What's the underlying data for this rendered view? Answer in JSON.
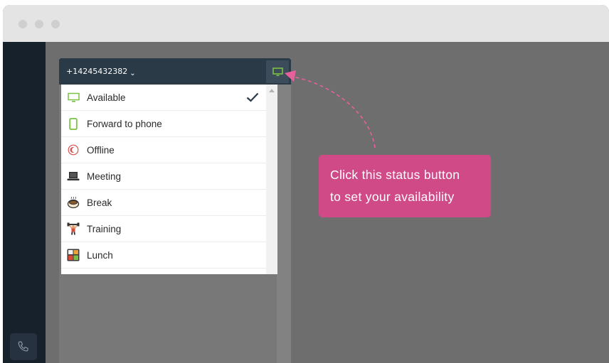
{
  "header": {
    "phone_number": "+14245432382",
    "dropdown_glyph": "⌄"
  },
  "status_menu": {
    "selected": "Available",
    "items": [
      {
        "label": "Available",
        "icon": "monitor-icon",
        "color": "#7ac142"
      },
      {
        "label": "Forward to phone",
        "icon": "mobile-icon",
        "color": "#7ac142"
      },
      {
        "label": "Offline",
        "icon": "moon-icon",
        "color": "#d9534f"
      },
      {
        "label": "Meeting",
        "icon": "laptop-icon"
      },
      {
        "label": "Break",
        "icon": "coffee-icon"
      },
      {
        "label": "Training",
        "icon": "weightlifter-icon"
      },
      {
        "label": "Lunch",
        "icon": "bento-icon"
      }
    ]
  },
  "callout": {
    "line1": "Click this status button",
    "line2": "to set your availability",
    "color": "#cf4a87"
  },
  "colors": {
    "sidebar": "#17212b",
    "header": "#2b3a47",
    "accent_green": "#7ac142"
  }
}
